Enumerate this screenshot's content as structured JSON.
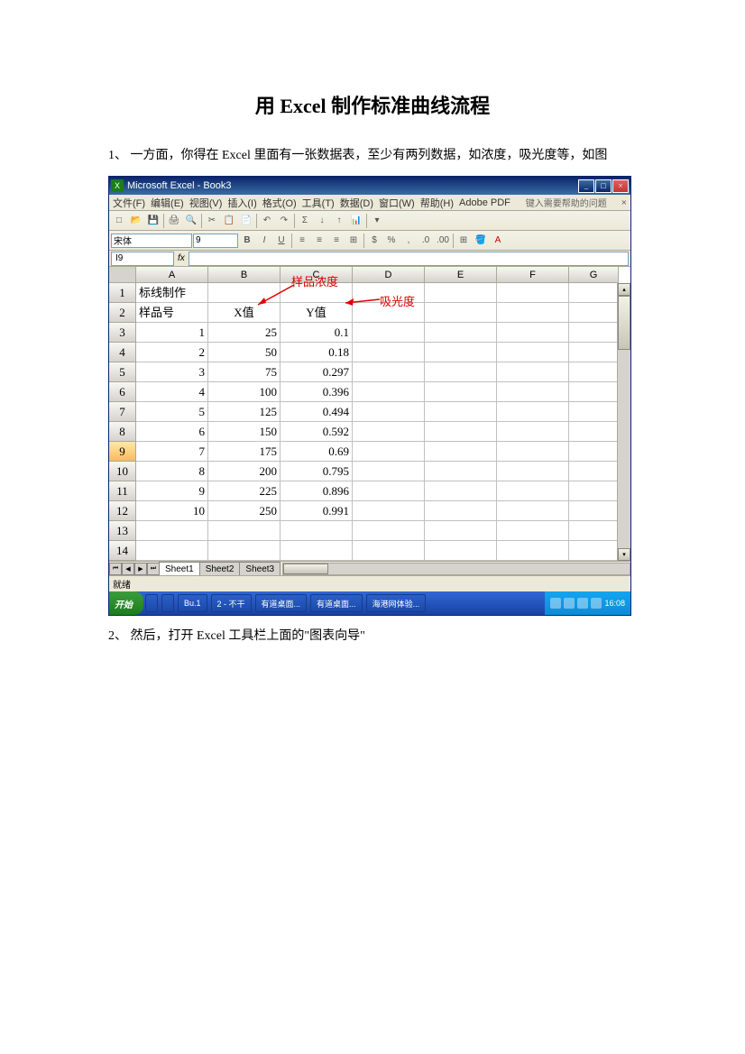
{
  "doc": {
    "title": "用 Excel 制作标准曲线流程",
    "step1": "1、 一方面，你得在 Excel 里面有一张数据表，至少有两列数据，如浓度，吸光度等，如图",
    "step2": "2、 然后，打开 Excel 工具栏上面的\"图表向导\""
  },
  "excel": {
    "title": "Microsoft Excel - Book3",
    "menus": [
      "文件(F)",
      "编辑(E)",
      "视图(V)",
      "插入(I)",
      "格式(O)",
      "工具(T)",
      "数据(D)",
      "窗口(W)",
      "帮助(H)",
      "Adobe PDF"
    ],
    "help_hint": "键入需要帮助的问题",
    "font_name": "宋体",
    "font_size": "9",
    "name_box": "I9",
    "columns": [
      "A",
      "B",
      "C",
      "D",
      "E",
      "F",
      "G"
    ],
    "row_numbers": [
      "1",
      "2",
      "3",
      "4",
      "5",
      "6",
      "7",
      "8",
      "9",
      "10",
      "11",
      "12",
      "13",
      "14"
    ],
    "selected_row": 9,
    "cells": {
      "A1": "标线制作",
      "A2": "样品号",
      "B2": "X值",
      "C2": "Y值",
      "A3": "1",
      "B3": "25",
      "C3": "0.1",
      "A4": "2",
      "B4": "50",
      "C4": "0.18",
      "A5": "3",
      "B5": "75",
      "C5": "0.297",
      "A6": "4",
      "B6": "100",
      "C6": "0.396",
      "A7": "5",
      "B7": "125",
      "C7": "0.494",
      "A8": "6",
      "B8": "150",
      "C8": "0.592",
      "A9": "7",
      "B9": "175",
      "C9": "0.69",
      "A10": "8",
      "B10": "200",
      "C10": "0.795",
      "A11": "9",
      "B11": "225",
      "C11": "0.896",
      "A12": "10",
      "B12": "250",
      "C12": "0.991"
    },
    "sheet_tabs": [
      "Sheet1",
      "Sheet2",
      "Sheet3"
    ],
    "active_sheet": 0,
    "status": "就绪"
  },
  "annotations": {
    "anno1": "样品浓度",
    "anno2": "吸光度"
  },
  "taskbar": {
    "start": "开始",
    "items": [
      "",
      "",
      "Bu.1",
      "2 - 不干",
      "有道桌面...",
      "有道桌面...",
      "海港网体验..."
    ],
    "time": "16:08"
  },
  "chart_data": {
    "type": "table",
    "title": "标线制作",
    "columns": [
      "样品号",
      "X值",
      "Y值"
    ],
    "column_meaning": {
      "X值": "样品浓度",
      "Y值": "吸光度"
    },
    "rows": [
      [
        1,
        25,
        0.1
      ],
      [
        2,
        50,
        0.18
      ],
      [
        3,
        75,
        0.297
      ],
      [
        4,
        100,
        0.396
      ],
      [
        5,
        125,
        0.494
      ],
      [
        6,
        150,
        0.592
      ],
      [
        7,
        175,
        0.69
      ],
      [
        8,
        200,
        0.795
      ],
      [
        9,
        225,
        0.896
      ],
      [
        10,
        250,
        0.991
      ]
    ]
  }
}
